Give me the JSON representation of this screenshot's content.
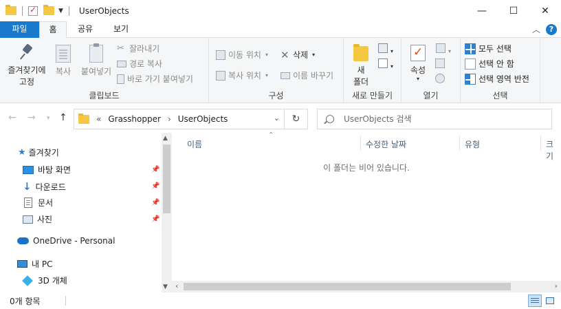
{
  "window": {
    "title": "UserObjects",
    "minimize": "—",
    "maximize": "☐",
    "close": "✕"
  },
  "ribbon_tabs": {
    "file": "파일",
    "home": "홈",
    "share": "공유",
    "view": "보기",
    "help": "?"
  },
  "clipboard": {
    "pin_l1": "즐겨찾기에",
    "pin_l2": "고정",
    "copy": "복사",
    "paste": "붙여넣기",
    "cut": "잘라내기",
    "copy_path": "경로 복사",
    "paste_shortcut": "바로 가기 붙여넣기",
    "label": "클립보드"
  },
  "organize": {
    "move_to": "이동 위치",
    "copy_to": "복사 위치",
    "delete": "삭제",
    "rename": "이름 바꾸기",
    "label": "구성"
  },
  "new": {
    "folder_l1": "새",
    "folder_l2": "폴더",
    "label": "새로 만들기"
  },
  "open": {
    "properties": "속성",
    "label": "열기"
  },
  "select": {
    "select_all": "모두 선택",
    "select_none": "선택 안 함",
    "invert": "선택 영역 반전",
    "label": "선택"
  },
  "address": {
    "overflow": "«",
    "crumbs": [
      "Grasshopper",
      "UserObjects"
    ],
    "separator": "›"
  },
  "search": {
    "placeholder": "UserObjects 검색"
  },
  "navpane": {
    "quick_access": "즐겨찾기",
    "desktop": "바탕 화면",
    "downloads": "다운로드",
    "documents": "문서",
    "pictures": "사진",
    "onedrive": "OneDrive - Personal",
    "this_pc": "내 PC",
    "objects3d": "3D 개체"
  },
  "columns": {
    "name": "이름",
    "modified": "수정한 날짜",
    "type": "유형",
    "size": "크기"
  },
  "content": {
    "empty_message": "이 폴더는 비어 있습니다."
  },
  "status": {
    "item_count": "0개 항목"
  }
}
